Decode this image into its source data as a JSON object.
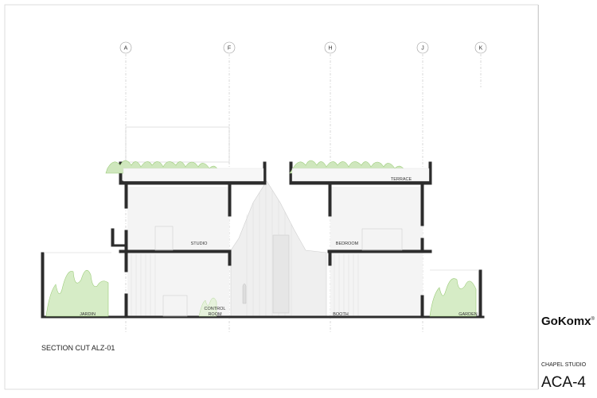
{
  "grid_labels": [
    "A",
    "F",
    "H",
    "J",
    "K"
  ],
  "rooms": {
    "terrace": "TERRACE",
    "studio": "STUDIO",
    "bedroom": "BEDROOM",
    "control_room_line1": "CONTROL",
    "control_room_line2": "ROOM",
    "booth": "BOOTH",
    "jardin": "JARDIN",
    "garden": "GARDEN"
  },
  "caption": "SECTION CUT ALZ-01",
  "title_block": {
    "brand": "GoKomx",
    "brand_mark": "®",
    "project": "CHAPEL STUDIO",
    "sheet_code": "ACA-4"
  },
  "colors": {
    "line": "#333333",
    "grid": "#aaaaaa",
    "plant": "#9ccc7a",
    "plant_dark": "#6fa85a",
    "fill": "#f3f3f3"
  }
}
